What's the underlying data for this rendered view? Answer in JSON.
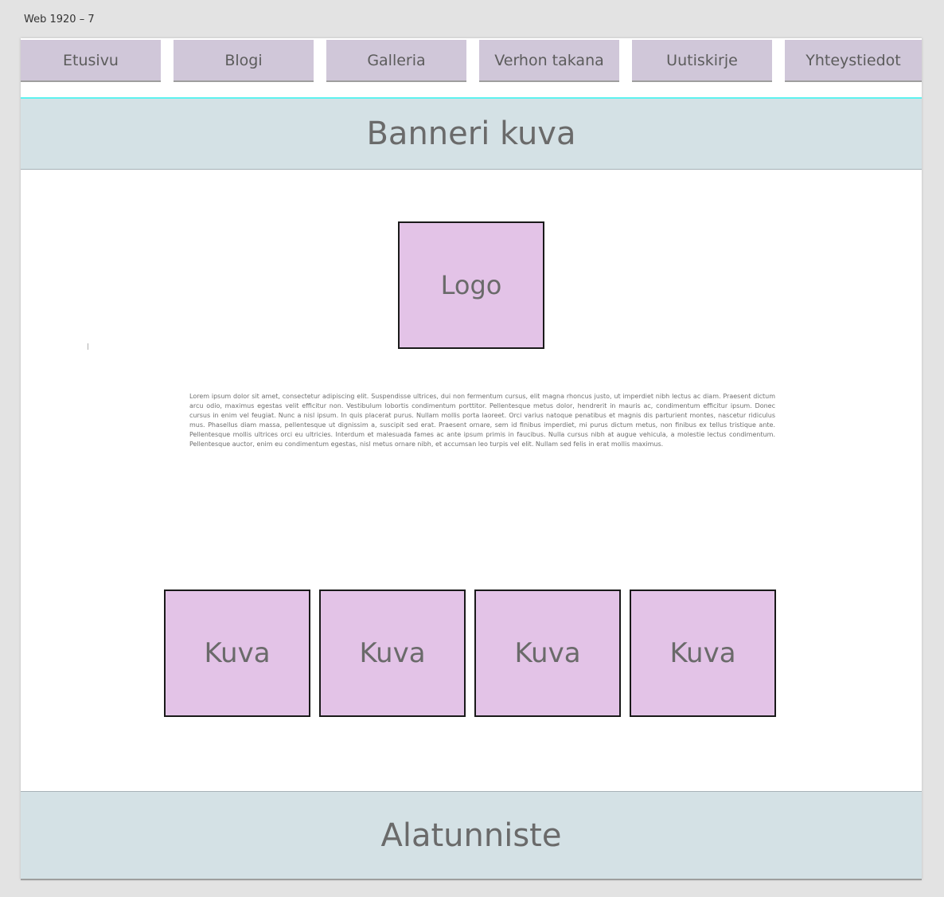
{
  "artboard": {
    "title": "Web 1920 – 7"
  },
  "nav": {
    "items": [
      {
        "label": "Etusivu"
      },
      {
        "label": "Blogi"
      },
      {
        "label": "Galleria"
      },
      {
        "label": "Verhon takana"
      },
      {
        "label": "Uutiskirje"
      },
      {
        "label": "Yhteystiedot"
      }
    ]
  },
  "banner": {
    "text": "Banneri kuva"
  },
  "logo": {
    "text": "Logo"
  },
  "body": {
    "text": "Lorem ipsum dolor sit amet, consectetur adipiscing elit. Suspendisse ultrices, dui non fermentum cursus, elit magna rhoncus justo, ut imperdiet nibh lectus ac diam. Praesent dictum arcu odio, maximus egestas velit efficitur non. Vestibulum lobortis condimentum porttitor. Pellentesque metus dolor, hendrerit in mauris ac, condimentum efficitur ipsum. Donec cursus in enim vel feugiat. Nunc a nisl ipsum. In quis placerat purus. Nullam mollis porta laoreet. Orci varius natoque penatibus et magnis dis parturient montes, nascetur ridiculus mus. Phasellus diam massa, pellentesque ut dignissim a, suscipit sed erat. Praesent ornare, sem id finibus imperdiet, mi purus dictum metus, non finibus ex tellus tristique ante. Pellentesque mollis ultrices orci eu ultricies. Interdum et malesuada fames ac ante ipsum primis in faucibus. Nulla cursus nibh at augue vehicula, a molestie lectus condimentum. Pellentesque auctor, enim eu condimentum egestas, nisl metus ornare nibh, et accumsan leo turpis vel elit. Nullam sed felis in erat mollis maximus."
  },
  "gallery": {
    "items": [
      {
        "label": "Kuva"
      },
      {
        "label": "Kuva"
      },
      {
        "label": "Kuva"
      },
      {
        "label": "Kuva"
      }
    ]
  },
  "footer": {
    "text": "Alatunniste"
  },
  "colors": {
    "canvas_background": "#e3e3e3",
    "nav_background": "#d0c7d9",
    "banner_background": "#d4e1e5",
    "placeholder_fill": "#e3c3e7",
    "accent_line": "#5ef2ef"
  }
}
